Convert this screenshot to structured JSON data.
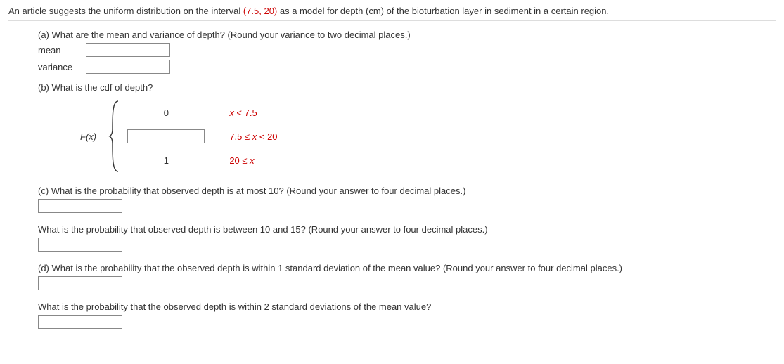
{
  "intro": {
    "before": "An article suggests the uniform distribution on the interval ",
    "interval": "(7.5, 20)",
    "after": " as a model for depth (cm) of the bioturbation layer in sediment in a certain region."
  },
  "partA": {
    "prompt": "(a) What are the mean and variance of depth? (Round your variance to two decimal places.)",
    "mean_label": "mean",
    "variance_label": "variance"
  },
  "partB": {
    "prompt": "(b) What is the cdf of depth?",
    "fx": "F(x) = ",
    "cases": [
      {
        "val": "0",
        "cond_x": "x",
        "cond_rest": " < 7.5"
      },
      {
        "val": "",
        "cond": "7.5 ≤ x < 20"
      },
      {
        "val": "1",
        "cond": "20 ≤ x"
      }
    ],
    "cond1_before": "",
    "cond2_pre": "7.5 ≤ ",
    "cond2_x": "x",
    "cond2_post": " < 20",
    "cond3_pre": "20 ≤ ",
    "cond3_x": "x"
  },
  "partC": {
    "q1": "(c) What is the probability that observed depth is at most 10? (Round your answer to four decimal places.)",
    "q2": "What is the probability that observed depth is between 10 and 15? (Round your answer to four decimal places.)"
  },
  "partD": {
    "q1": "(d) What is the probability that the observed depth is within 1 standard deviation of the mean value? (Round your answer to four decimal places.)",
    "q2": "What is the probability that the observed depth is within 2 standard deviations of the mean value?"
  }
}
